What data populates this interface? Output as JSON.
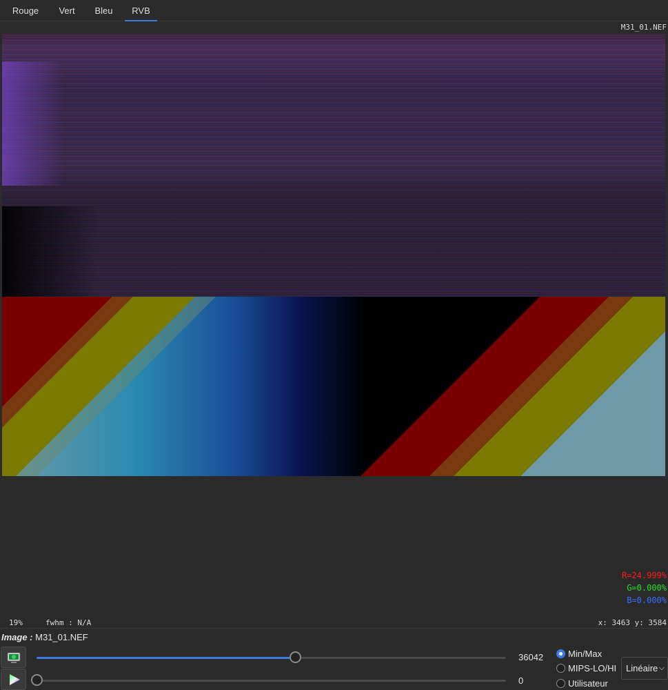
{
  "tabs": [
    {
      "label": "Rouge"
    },
    {
      "label": "Vert"
    },
    {
      "label": "Bleu"
    },
    {
      "label": "RVB",
      "active": true
    }
  ],
  "viewer": {
    "filename": "M31_01.NEF",
    "readout": {
      "r": "R=24.999%",
      "g": "G=0.000%",
      "b": "B=0.000%"
    },
    "colors": {
      "r": "#ff1a1a",
      "g": "#22e022",
      "b": "#3a6cff"
    },
    "zoom": "19%",
    "fwhm": "fwhm : N/A",
    "coords": "x: 3463 y: 3584"
  },
  "panel": {
    "image_label_prefix": "Image :",
    "image_name": "M31_01.NEF",
    "high_value": "36042",
    "low_value": "0",
    "high_fraction": 0.55,
    "low_fraction": 0.0,
    "icons": [
      "image-preview-icon",
      "color-triangle-icon"
    ],
    "radios": [
      {
        "label": "Min/Max",
        "checked": true
      },
      {
        "label": "MIPS-LO/HI",
        "checked": false
      },
      {
        "label": "Utilisateur",
        "checked": false
      }
    ],
    "scale_select": "Linéaire"
  },
  "accent_color": "#3d7be0"
}
